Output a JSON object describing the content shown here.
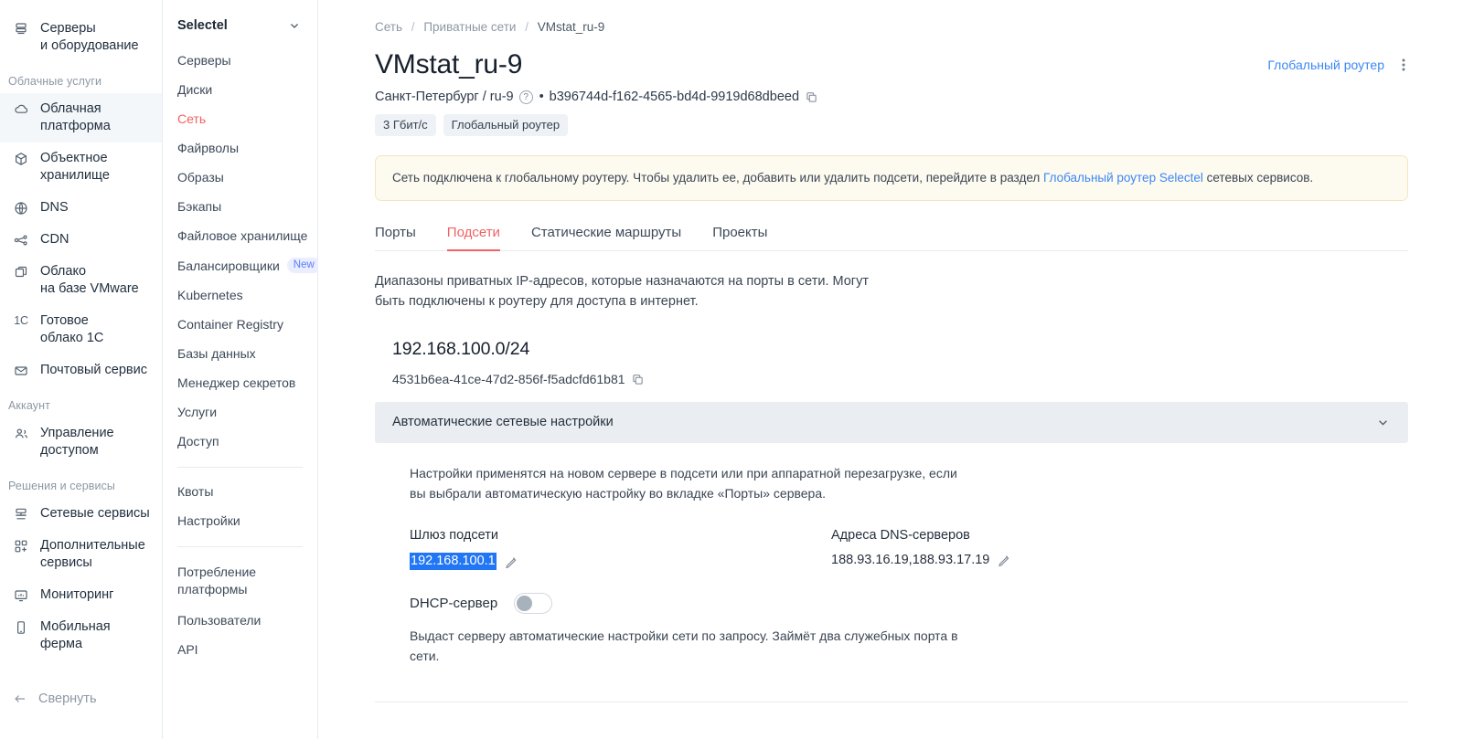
{
  "nav_primary": {
    "items": [
      {
        "label": "Серверы\nи оборудование",
        "icon": "server-rack-icon",
        "active": false
      }
    ],
    "groups": [
      {
        "title": "Облачные услуги",
        "items": [
          {
            "label": "Облачная\nплатформа",
            "icon": "cloud-icon",
            "active": true
          },
          {
            "label": "Объектное\nхранилище",
            "icon": "cube-icon",
            "active": false
          },
          {
            "label": "DNS",
            "icon": "globe-icon",
            "active": false
          },
          {
            "label": "CDN",
            "icon": "network-nodes-icon",
            "active": false
          },
          {
            "label": "Облако\nна базе VMware",
            "icon": "windows-copy-icon",
            "active": false
          },
          {
            "label": "Готовое\nоблако 1С",
            "icon": "1c-icon",
            "active": false
          },
          {
            "label": "Почтовый сервис",
            "icon": "envelope-icon",
            "active": false
          }
        ]
      },
      {
        "title": "Аккаунт",
        "items": [
          {
            "label": "Управление\nдоступом",
            "icon": "users-icon",
            "active": false
          }
        ]
      },
      {
        "title": "Решения и сервисы",
        "items": [
          {
            "label": "Сетевые сервисы",
            "icon": "network-switch-icon",
            "active": false
          },
          {
            "label": "Дополнительные\nсервисы",
            "icon": "grid-plus-icon",
            "active": false
          },
          {
            "label": "Мониторинг",
            "icon": "monitor-icon",
            "active": false
          },
          {
            "label": "Мобильная ферма",
            "icon": "mobile-icon",
            "active": false
          }
        ]
      }
    ],
    "collapse_label": "Свернуть",
    "collapse_icon": "arrow-left-icon"
  },
  "nav_project": {
    "name": "Selectel",
    "chevron_icon": "chevron-down-icon",
    "sections": [
      {
        "items": [
          {
            "label": "Серверы",
            "active": false
          },
          {
            "label": "Диски",
            "active": false
          },
          {
            "label": "Сеть",
            "active": true
          },
          {
            "label": "Файрволы",
            "active": false
          },
          {
            "label": "Образы",
            "active": false
          },
          {
            "label": "Бэкапы",
            "active": false
          },
          {
            "label": "Файловое хранилище",
            "active": false
          },
          {
            "label": "Балансировщики",
            "active": false,
            "badge": "New"
          },
          {
            "label": "Kubernetes",
            "active": false
          },
          {
            "label": "Container Registry",
            "active": false
          },
          {
            "label": "Базы данных",
            "active": false
          },
          {
            "label": "Менеджер секретов",
            "active": false
          },
          {
            "label": "Услуги",
            "active": false
          },
          {
            "label": "Доступ",
            "active": false
          }
        ]
      },
      {
        "items": [
          {
            "label": "Квоты",
            "active": false
          },
          {
            "label": "Настройки",
            "active": false
          }
        ]
      },
      {
        "items": [
          {
            "label": "Потребление\nплатформы",
            "active": false
          },
          {
            "label": "Пользователи",
            "active": false
          },
          {
            "label": "API",
            "active": false
          }
        ]
      }
    ]
  },
  "breadcrumb": {
    "items": [
      "Сеть",
      "Приватные сети",
      "VMstat_ru-9"
    ],
    "separator": "/"
  },
  "header": {
    "title": "VMstat_ru-9",
    "region": "Санкт-Петербург / ru-9",
    "help_icon": "question-circle-icon",
    "bullet": "•",
    "uuid": "b396744d-f162-4565-bd4d-9919d68dbeed",
    "copy_icon": "copy-icon",
    "chips": [
      "3 Гбит/с",
      "Глобальный роутер"
    ],
    "global_router_link": "Глобальный роутер",
    "kebab_icon": "kebab-menu-icon"
  },
  "notice": {
    "text_before": "Сеть подключена к глобальному роутеру. Чтобы удалить ее, добавить или удалить подсети, перейдите в раздел ",
    "link": "Глобальный роутер Selectel",
    "text_after": " сетевых сервисов."
  },
  "tabs": [
    {
      "label": "Порты",
      "active": false
    },
    {
      "label": "Подсети",
      "active": true
    },
    {
      "label": "Статические маршруты",
      "active": false
    },
    {
      "label": "Проекты",
      "active": false
    }
  ],
  "description": "Диапазоны приватных IP-адресов, которые назначаются на порты в сети. Могут быть подключены к роутеру для доступа в интернет.",
  "subnet": {
    "cidr": "192.168.100.0/24",
    "uuid": "4531b6ea-41ce-47d2-856f-f5adcfd61b81",
    "copy_icon": "copy-icon",
    "accordion_title": "Автоматические сетевые настройки",
    "accordion_chevron": "chevron-down-icon",
    "panel_note": "Настройки применятся на новом сервере в подсети или при аппаратной перезагрузке, если вы выбрали автоматическую настройку во вкладке «Порты» сервера.",
    "gateway_label": "Шлюз подсети",
    "gateway_value": "192.168.100.1",
    "gateway_selected": true,
    "dns_label": "Адреса DNS-серверов",
    "dns_value": "188.93.16.19,188.93.17.19",
    "edit_icon": "pencil-icon",
    "dhcp_label": "DHCP-сервер",
    "dhcp_enabled": false,
    "dhcp_note": "Выдаст серверу автоматические настройки сети по запросу. Займёт два служебных порта в сети."
  },
  "colors": {
    "accent_red": "#f26163",
    "link_blue": "#3d87f5",
    "selection_blue": "#2176f5",
    "notice_bg": "#fdfaef",
    "notice_border": "#f3e6bf",
    "accordion_bg": "#eaeef2",
    "chip_bg": "#eef1f5",
    "badge_bg": "#eaeeff",
    "badge_text": "#5b7cfa"
  }
}
